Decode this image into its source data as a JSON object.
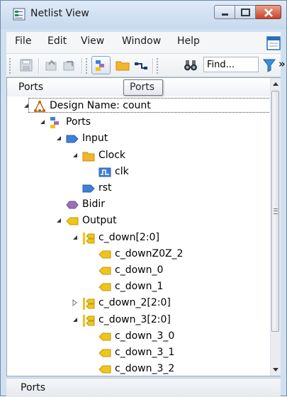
{
  "window": {
    "title": "Netlist View"
  },
  "menu": {
    "items": [
      "File",
      "Edit",
      "View",
      "Window",
      "Help"
    ]
  },
  "toolbar": {
    "search_placeholder": "Find...",
    "icons": [
      "save-icon",
      "open-back-icon",
      "open-forward-icon",
      "ports-view-icon",
      "folder-icon",
      "net-icon",
      "binoculars-icon",
      "filter-icon"
    ],
    "overflow": "»"
  },
  "panel": {
    "title": "Ports",
    "tooltip": "Ports",
    "tree": [
      {
        "label": "Design Name: count",
        "icon": "design-icon",
        "depth": 0,
        "expander": "expanded"
      },
      {
        "label": "Ports",
        "icon": "ports-icon",
        "depth": 1,
        "expander": "expanded"
      },
      {
        "label": "Input",
        "icon": "input-port-icon",
        "depth": 2,
        "expander": "expanded"
      },
      {
        "label": "Clock",
        "icon": "folder-icon",
        "depth": 3,
        "expander": "expanded"
      },
      {
        "label": "clk",
        "icon": "clock-port-icon",
        "depth": 4,
        "expander": "none"
      },
      {
        "label": "rst",
        "icon": "input-port-icon",
        "depth": 3,
        "expander": "none"
      },
      {
        "label": "Bidir",
        "icon": "bidir-port-icon",
        "depth": 2,
        "expander": "none"
      },
      {
        "label": "Output",
        "icon": "output-port-icon",
        "depth": 2,
        "expander": "expanded"
      },
      {
        "label": "c_down[2:0]",
        "icon": "bus-icon",
        "depth": 3,
        "expander": "expanded"
      },
      {
        "label": "c_downZ0Z_2",
        "icon": "output-port-icon",
        "depth": 4,
        "expander": "none"
      },
      {
        "label": "c_down_0",
        "icon": "output-port-icon",
        "depth": 4,
        "expander": "none"
      },
      {
        "label": "c_down_1",
        "icon": "output-port-icon",
        "depth": 4,
        "expander": "none"
      },
      {
        "label": "c_down_2[2:0]",
        "icon": "bus-icon",
        "depth": 3,
        "expander": "collapsed"
      },
      {
        "label": "c_down_3[2:0]",
        "icon": "bus-icon",
        "depth": 3,
        "expander": "expanded"
      },
      {
        "label": "c_down_3_0",
        "icon": "output-port-icon",
        "depth": 4,
        "expander": "none"
      },
      {
        "label": "c_down_3_1",
        "icon": "output-port-icon",
        "depth": 4,
        "expander": "none"
      },
      {
        "label": "c_down_3_2",
        "icon": "output-port-icon",
        "depth": 4,
        "expander": "none"
      }
    ]
  },
  "status": {
    "text": "Ports"
  },
  "colors": {
    "input_port": "#3f7fd6",
    "output_port": "#f0c419",
    "bidir_port": "#9b6fb8",
    "folder": "#f3b52b",
    "title_bg": "#cfe0f1",
    "close_button": "#c8442a"
  }
}
